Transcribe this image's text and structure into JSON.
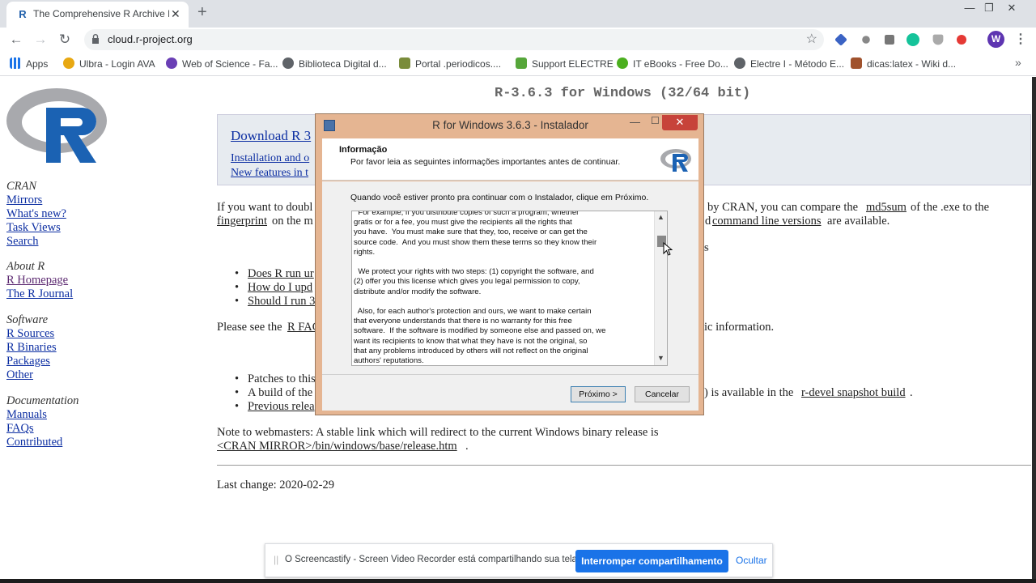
{
  "browser": {
    "tab_title": "The Comprehensive R Archive Net",
    "url": "cloud.r-project.org",
    "avatar_letter": "W",
    "bookmarks": [
      "Apps",
      "Ulbra - Login AVA",
      "Web of Science - Fa...",
      "Biblioteca Digital d...",
      "Portal .periodicos....",
      "Support ELECTRE",
      "IT eBooks - Free Do...",
      "Electre I - Método E...",
      "dicas:latex - Wiki d..."
    ]
  },
  "sidebar": {
    "cran_heading": "CRAN",
    "cran_links": [
      "Mirrors",
      "What's new?",
      "Task Views",
      "Search"
    ],
    "about_heading": "About R",
    "about_links": [
      "R Homepage",
      "The R Journal"
    ],
    "software_heading": "Software",
    "software_links": [
      "R Sources",
      "R Binaries",
      "Packages",
      "Other"
    ],
    "doc_heading": "Documentation",
    "doc_links": [
      "Manuals",
      "FAQs",
      "Contributed"
    ]
  },
  "main": {
    "title": "R-3.6.3 for Windows (32/64 bit)",
    "download_link": "Download R 3",
    "install_link": "Installation and o",
    "new_features_link": "New features in t",
    "p1_start": "If you want to doubl",
    "p1_right_a": "by CRAN, you can compare the",
    "md5": "md5sum",
    "p1_right_b": "of the .exe to the",
    "fingerprint": "fingerprint",
    "p1_mid": "on the m",
    "p2_right_pre": "d",
    "cmdline": "command line versions",
    "p2_right_b": "are available.",
    "faq_fragment": "s",
    "faq_items": [
      "Does R run ur",
      "How do I upd",
      "Should I run 3"
    ],
    "see_faq_pre": "Please see the",
    "rfaq": "R FAQ",
    "see_faq_right": "ic information.",
    "patches": "Patches to this",
    "build": "A build of the",
    "build_right_pre": ") is available in the",
    "snapshot": "r-devel snapshot build",
    "build_right_post": ".",
    "previous": "Previous relea",
    "note": "Note to webmasters: A stable link which will redirect to the current Windows binary release is",
    "note_link": "<CRAN MIRROR>/bin/windows/base/release.htm",
    "note_end": ".",
    "last_change": "Last change: 2020-02-29"
  },
  "dialog": {
    "title": "R for Windows 3.6.3 - Instalador",
    "heading": "Informação",
    "subheading": "Por favor leia as seguintes informações importantes antes de continuar.",
    "intro": "Quando você estiver pronto pra continuar com o Instalador, clique em Próximo.",
    "license_text": "  For example, if you distribute copies of such a program, whether\ngratis or for a fee, you must give the recipients all the rights that\nyou have.  You must make sure that they, too, receive or can get the\nsource code.  And you must show them these terms so they know their\nrights.\n\n  We protect your rights with two steps: (1) copyright the software, and\n(2) offer you this license which gives you legal permission to copy,\ndistribute and/or modify the software.\n\n  Also, for each author's protection and ours, we want to make certain\nthat everyone understands that there is no warranty for this free\nsoftware.  If the software is modified by someone else and passed on, we\nwant its recipients to know that what they have is not the original, so\nthat any problems introduced by others will not reflect on the original\nauthors' reputations.",
    "next_button": "Próximo >",
    "cancel_button": "Cancelar"
  },
  "share_bar": {
    "message": "O Screencastify - Screen Video Recorder está compartilhando sua tela.",
    "stop_button": "Interromper compartilhamento",
    "hide_link": "Ocultar"
  },
  "colors": {
    "link": "#0c2ea2",
    "visited_link": "#5b2870",
    "dialog_frame": "#e5b592",
    "close_red": "#c7433a",
    "share_blue": "#1a73e8"
  }
}
